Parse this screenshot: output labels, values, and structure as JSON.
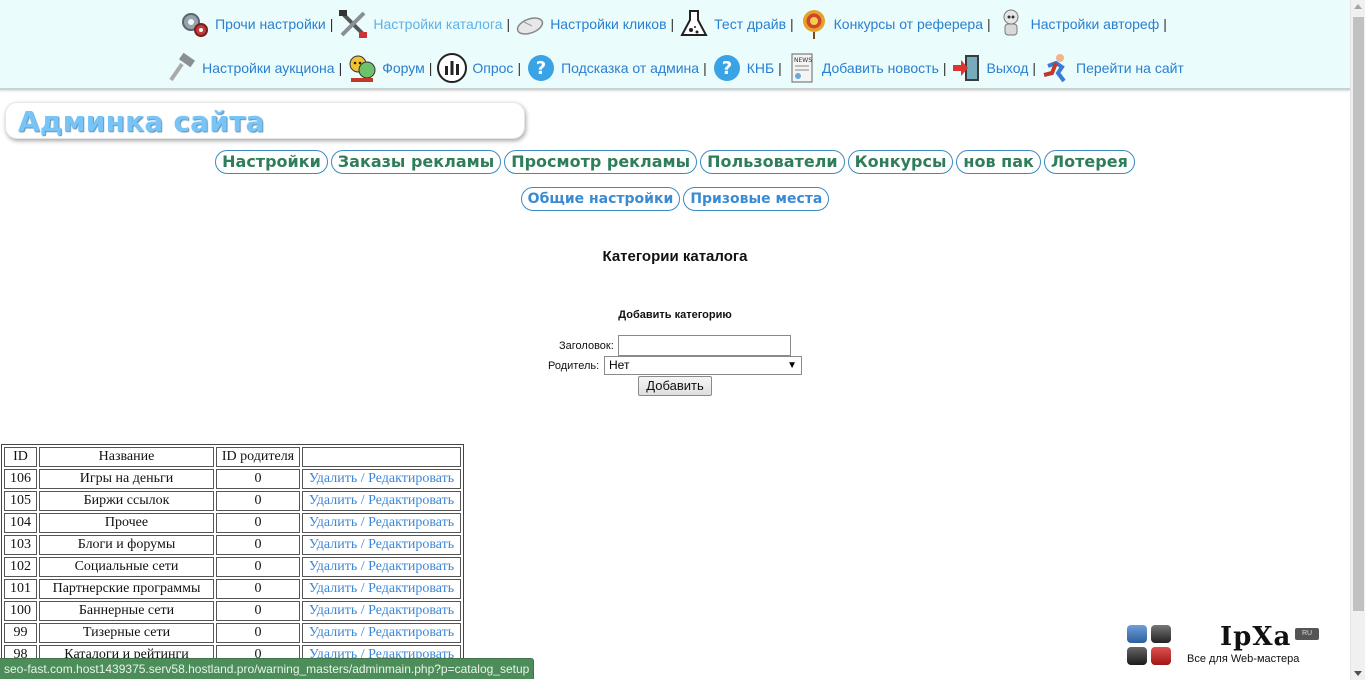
{
  "nav": {
    "row1": [
      {
        "label": "Прочи настройки",
        "icon": "gears-icon",
        "active": false
      },
      {
        "label": "Настройки каталога",
        "icon": "tools-icon",
        "active": true
      },
      {
        "label": "Настройки кликов",
        "icon": "mouse-icon",
        "active": false
      },
      {
        "label": "Тест драйв",
        "icon": "flask-icon",
        "active": false
      },
      {
        "label": "Конкурсы от реферера",
        "icon": "target-icon",
        "active": false
      },
      {
        "label": "Настройки автореф",
        "icon": "robot-icon",
        "active": false
      }
    ],
    "row2": [
      {
        "label": "Настройки аукциона",
        "icon": "gavel-icon",
        "active": false
      },
      {
        "label": "Форум",
        "icon": "forum-icon",
        "active": false
      },
      {
        "label": "Опрос",
        "icon": "poll-icon",
        "active": false
      },
      {
        "label": "Подсказка от админа",
        "icon": "help-icon",
        "active": false
      },
      {
        "label": "КНБ",
        "icon": "help-icon",
        "active": false
      },
      {
        "label": "Добавить новость",
        "icon": "news-icon",
        "active": false
      },
      {
        "label": "Выход",
        "icon": "exit-icon",
        "active": false
      },
      {
        "label": "Перейти на сайт",
        "icon": "runner-icon",
        "active": false
      }
    ],
    "separator": "|"
  },
  "header": {
    "title": "Админка сайта"
  },
  "main_menu": [
    "Настройки",
    "Заказы рекламы",
    "Просмотр рекламы",
    "Пользователи",
    "Конкурсы",
    "нов пак",
    "Лотерея"
  ],
  "sub_menu": [
    "Общие настройки",
    "Призовые места"
  ],
  "page": {
    "heading": "Категории каталога",
    "form_heading": "Добавить категорию",
    "title_label": "Заголовок:",
    "title_value": "",
    "parent_label": "Родитель:",
    "parent_value": "Нет",
    "submit_label": "Добавить"
  },
  "table": {
    "headers": [
      "ID",
      "Название",
      "ID родителя",
      ""
    ],
    "action_label": "Удалить / Редактировать",
    "rows": [
      {
        "id": "106",
        "name": "Игры на деньги",
        "parent": "0"
      },
      {
        "id": "105",
        "name": "Биржи ссылок",
        "parent": "0"
      },
      {
        "id": "104",
        "name": "Прочее",
        "parent": "0"
      },
      {
        "id": "103",
        "name": "Блоги и форумы",
        "parent": "0"
      },
      {
        "id": "102",
        "name": "Социальные сети",
        "parent": "0"
      },
      {
        "id": "101",
        "name": "Партнерские программы",
        "parent": "0"
      },
      {
        "id": "100",
        "name": "Баннерные сети",
        "parent": "0"
      },
      {
        "id": "99",
        "name": "Тизерные сети",
        "parent": "0"
      },
      {
        "id": "98",
        "name": "Каталоги и рейтинги",
        "parent": "0"
      }
    ]
  },
  "status_url": "seo-fast.com.host1439375.serv58.hostland.pro/warning_masters/adminmain.php?p=catalog_setup",
  "logo": {
    "name": "IpXa",
    "tld": "RU",
    "tagline": "Все для Web-мастера"
  },
  "colors": {
    "link": "#2a7fd0",
    "nav_bg": "#eafcfc",
    "title": "#79c4f6",
    "pill_main": "#2e7d5b",
    "pill_sub": "#3a8bd3",
    "status_bar": "#4c8d5a"
  }
}
